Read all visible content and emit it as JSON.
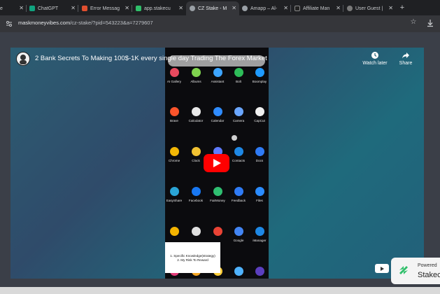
{
  "tabs": [
    {
      "label": "e",
      "color": "#5f6368"
    },
    {
      "label": "ChatGPT",
      "color": "#10a37f"
    },
    {
      "label": "Error Messag",
      "color": "#e04f2f"
    },
    {
      "label": "app.stakecu",
      "color": "#2fbf6a"
    },
    {
      "label": "CZ Stake - M",
      "color": "#9aa0a6"
    },
    {
      "label": "Amapp – Al-",
      "color": "#9aa0a6"
    },
    {
      "label": "Affiliate Man",
      "color": "#222222"
    },
    {
      "label": "User Guest |",
      "color": "#7a7a7a"
    }
  ],
  "address": {
    "host": "maskmoneyvibes.com",
    "path": "/cz-stake/?pid=543223&a=7279607"
  },
  "video": {
    "title": "2 Bank Secrets To Making 100$-1K every single day Trading The Forex Market",
    "watch_later": "Watch later",
    "share": "Share"
  },
  "apps": [
    {
      "label": "AI Gallery",
      "color": "#e84a5f"
    },
    {
      "label": "Albums",
      "color": "#7fd34e"
    },
    {
      "label": "Assistant",
      "color": "#3da5ff"
    },
    {
      "label": "Bolt",
      "color": "#2ebd59"
    },
    {
      "label": "Boomplay",
      "color": "#1f9bff"
    },
    {
      "label": "Brave",
      "color": "#fb542b"
    },
    {
      "label": "Calculator",
      "color": "#e8e8e8"
    },
    {
      "label": "Calendar",
      "color": "#2f8cff"
    },
    {
      "label": "Camera",
      "color": "#6aa6ff"
    },
    {
      "label": "CapCut",
      "color": "#f0f0f0"
    },
    {
      "label": "Chrome",
      "color": "#f2b705"
    },
    {
      "label": "Clock",
      "color": "#f1c232"
    },
    {
      "label": "",
      "color": "#5e7bff"
    },
    {
      "label": "Contacts",
      "color": "#1e88e5"
    },
    {
      "label": "Docs",
      "color": "#2f7bf5"
    },
    {
      "label": "EasyShare",
      "color": "#2aa4d6"
    },
    {
      "label": "Facebook",
      "color": "#1877f2"
    },
    {
      "label": "FairMoney",
      "color": "#2fbf71"
    },
    {
      "label": "Feedback",
      "color": "#2f7bf5"
    },
    {
      "label": "Files",
      "color": "#2b8cff"
    },
    {
      "label": "",
      "color": "#f4b400"
    },
    {
      "label": "",
      "color": "#e0e0e0"
    },
    {
      "label": "",
      "color": "#ea4335"
    },
    {
      "label": "Google",
      "color": "#4285f4"
    },
    {
      "label": "iManager",
      "color": "#1e88e5"
    },
    {
      "label": "",
      "color": "#e53c7a"
    },
    {
      "label": "",
      "color": "#f5a623"
    },
    {
      "label": "",
      "color": "#ffcf3a"
    },
    {
      "label": "",
      "color": "#4fb3ff"
    },
    {
      "label": "",
      "color": "#5b3fbf"
    }
  ],
  "note": {
    "line1": "1. Specific Knowledge(strategy)",
    "line2": "2. My Risk To Reward"
  },
  "badge": {
    "line1": "Powered",
    "line2": "Stakec"
  }
}
